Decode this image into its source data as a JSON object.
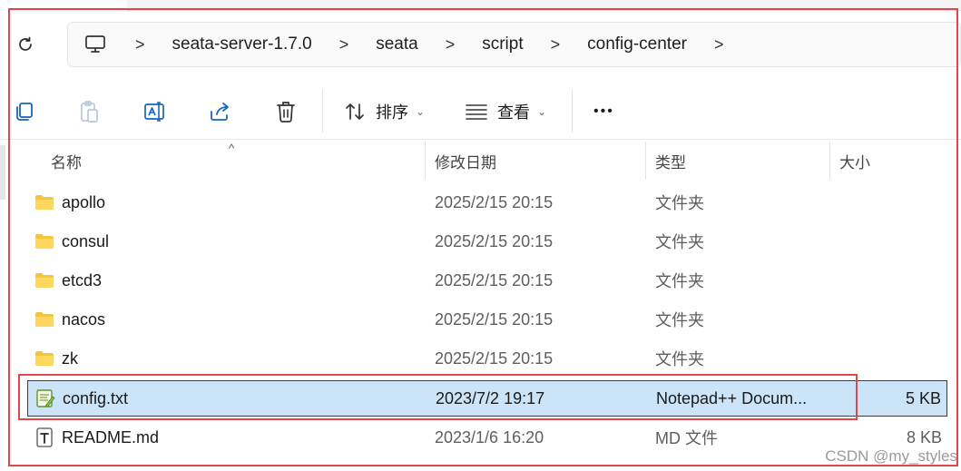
{
  "breadcrumb": {
    "items": [
      "seata-server-1.7.0",
      "seata",
      "script",
      "config-center"
    ],
    "separator": ">"
  },
  "toolbar": {
    "sort_label": "排序",
    "view_label": "查看",
    "more_label": "•••"
  },
  "columns": {
    "name": "名称",
    "date": "修改日期",
    "type": "类型",
    "size": "大小"
  },
  "files": [
    {
      "name": "apollo",
      "date": "2025/2/15 20:15",
      "type": "文件夹",
      "size": "",
      "icon": "folder-icon"
    },
    {
      "name": "consul",
      "date": "2025/2/15 20:15",
      "type": "文件夹",
      "size": "",
      "icon": "folder-icon"
    },
    {
      "name": "etcd3",
      "date": "2025/2/15 20:15",
      "type": "文件夹",
      "size": "",
      "icon": "folder-icon"
    },
    {
      "name": "nacos",
      "date": "2025/2/15 20:15",
      "type": "文件夹",
      "size": "",
      "icon": "folder-icon"
    },
    {
      "name": "zk",
      "date": "2025/2/15 20:15",
      "type": "文件夹",
      "size": "",
      "icon": "folder-icon"
    },
    {
      "name": "config.txt",
      "date": "2023/7/2 19:17",
      "type": "Notepad++ Docum...",
      "size": "5 KB",
      "icon": "notepadpp-file-icon",
      "selected": true
    },
    {
      "name": "README.md",
      "date": "2023/1/6 16:20",
      "type": "MD 文件",
      "size": "8 KB",
      "icon": "text-file-icon"
    }
  ],
  "watermark": "CSDN @my_styles",
  "colors": {
    "highlight": "#e0474c",
    "selection": "#cce4f7",
    "folder": "#f4c542"
  }
}
